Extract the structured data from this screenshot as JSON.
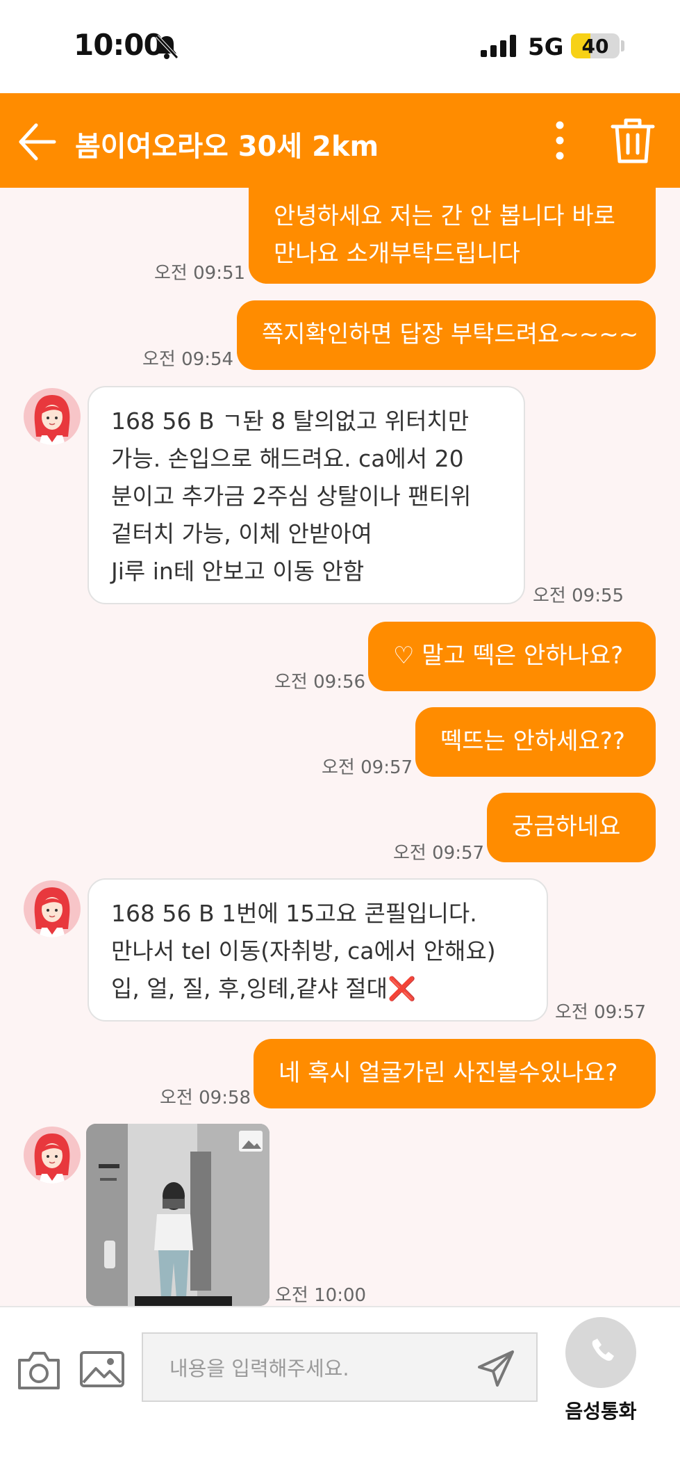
{
  "status_bar": {
    "time": "10:00",
    "network": "5G",
    "battery": "40",
    "battery_level": 0.4
  },
  "header": {
    "title": "봄이여오라오 30세 2km",
    "back_icon": "arrow-left-icon",
    "more_icon": "more-vertical-icon",
    "delete_icon": "trash-icon"
  },
  "messages": [
    {
      "side": "out",
      "lines": [
        "안녕하세요 저는 간 안 봅니다 바로",
        "만나요 소개부탁드립니다"
      ],
      "time": "오전 09:51"
    },
    {
      "side": "out",
      "lines": [
        "쪽지확인하면 답장 부탁드려요~~~~"
      ],
      "time": "오전 09:54"
    },
    {
      "side": "in",
      "lines": [
        "168 56 B ㄱ돤 8 탈의없고 위터치만",
        "가능. 손입으로 해드려요. ca에서 20",
        "분이고 추가금 2주심 상탈이나 팬티위",
        "겉터치 가능, 이체 안받아여",
        "Ji루 in테 안보고 이동 안함"
      ],
      "time": "오전 09:55"
    },
    {
      "side": "out",
      "lines": [
        "♡ 말고 떽은 안하나요?"
      ],
      "time": "오전 09:56"
    },
    {
      "side": "out",
      "lines": [
        "떽뜨는 안하세요??"
      ],
      "time": "오전 09:57"
    },
    {
      "side": "out",
      "lines": [
        "궁금하네요"
      ],
      "time": "오전 09:57"
    },
    {
      "side": "in",
      "lines": [
        "168 56 B 1번에 15고요 콘필입니다.",
        "만나서 tel 이동(자취방, ca에서 안해요)",
        "입, 얼, 질, 후,잉톄,걑샤 절대❌"
      ],
      "time": "오전 09:57"
    },
    {
      "side": "out",
      "lines": [
        "네 혹시 얼굴가린 사진볼수있나요?"
      ],
      "time": "오전 09:58"
    },
    {
      "side": "in",
      "type": "image",
      "time": "오전 10:00"
    }
  ],
  "input_bar": {
    "placeholder": "내용을 입력해주세요.",
    "call_label": "음성통화",
    "camera_icon": "camera-icon",
    "gallery_icon": "image-icon",
    "send_icon": "send-icon",
    "call_icon": "phone-icon"
  },
  "colors": {
    "accent": "#ff8c00",
    "background": "#fdf4f4",
    "incoming_bubble": "#ffffff"
  }
}
